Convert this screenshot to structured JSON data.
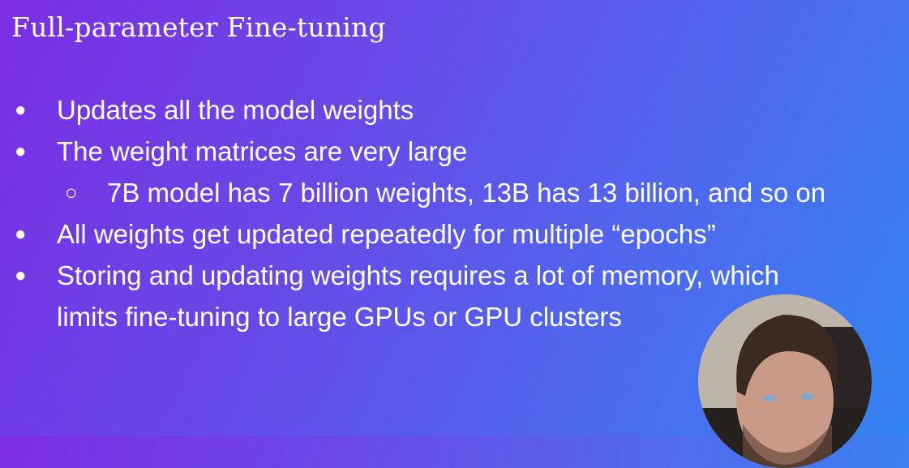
{
  "slide": {
    "title": "Full-parameter Fine-tuning",
    "bullets": [
      {
        "level": 1,
        "text": "Updates all the model weights"
      },
      {
        "level": 1,
        "text": "The weight matrices are very large"
      },
      {
        "level": 2,
        "text": "7B model has 7 billion weights, 13B has 13 billion, and so on"
      },
      {
        "level": 1,
        "text": "All weights get updated repeatedly for multiple “epochs”"
      },
      {
        "level": 1,
        "text": "Storing and updating weights requires a lot of memory, which"
      },
      {
        "level": 0,
        "text": "limits fine-tuning to large GPUs or GPU clusters"
      }
    ],
    "bullet_glyphs": {
      "level1": "●",
      "level2": "○"
    }
  },
  "colors": {
    "gradient_start": "#7c2fe3",
    "gradient_end": "#3486f2"
  }
}
